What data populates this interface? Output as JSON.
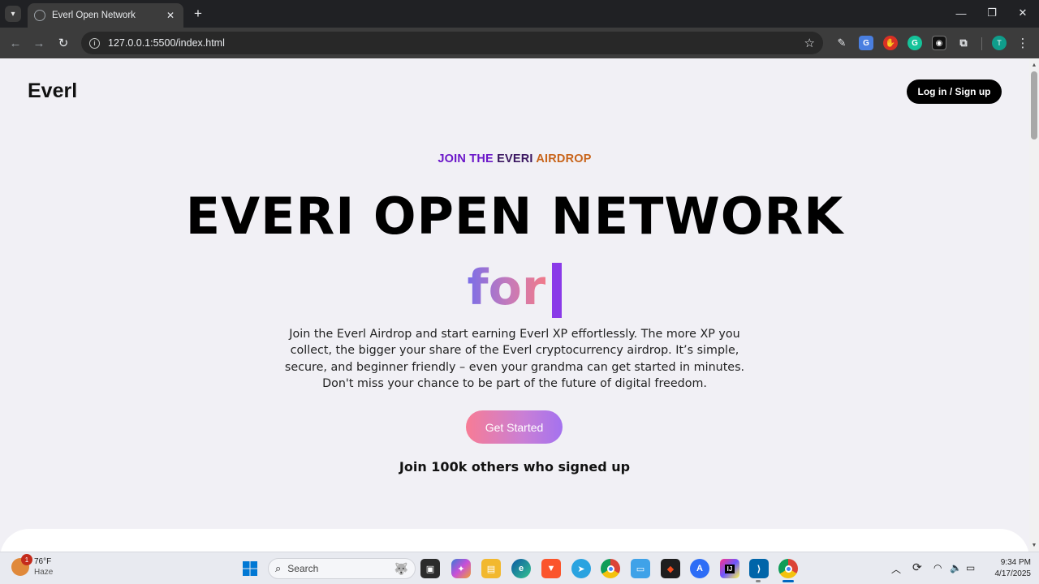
{
  "browser": {
    "tab_title": "Everl Open Network",
    "url": "127.0.0.1:5500/index.html",
    "profile_initial": "T"
  },
  "page": {
    "logo": "Everl",
    "login_label": "Log in / Sign up",
    "eyebrow": {
      "part1": "JOIN THE ",
      "part2": "EVERI ",
      "part3": "AIRDROP",
      "colors": [
        "#6b16c9",
        "#111111",
        "#c8641a"
      ]
    },
    "hero_title": "EVERI OPEN NETWORK",
    "typed_text": "for",
    "description": "Join the Everl Airdrop and start earning Everl XP effortlessly. The more XP you collect, the bigger your share of the Everl cryptocurrency airdrop. It’s simple, secure, and beginner friendly – even your grandma can get started in minutes. Don't miss your chance to be part of the future of digital freedom.",
    "cta_label": "Get Started",
    "social_proof": "Join 100k others who signed up"
  },
  "taskbar": {
    "weather_temp": "76°F",
    "weather_desc": "Haze",
    "weather_badge": "1",
    "search_placeholder": "Search",
    "time": "9:34 PM",
    "date": "4/17/2025"
  },
  "icons": [
    "search-icon",
    "star-icon",
    "info-icon",
    "windows-start-icon",
    "wifi-icon",
    "volume-icon",
    "battery-icon"
  ]
}
